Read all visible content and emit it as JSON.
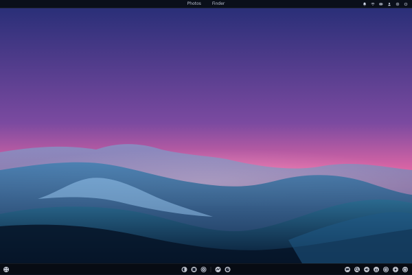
{
  "topbar": {
    "center_items": [
      "Photos",
      "Finder"
    ],
    "status_icons": [
      "bell-icon",
      "wifi-icon",
      "battery-icon",
      "user-icon",
      "gear-icon",
      "power-icon"
    ]
  },
  "wallpaper": {
    "sky_colors": [
      "#2b2e7a",
      "#ff6fa6",
      "#c7c8ff"
    ],
    "mountain_colors": [
      "#1b3b6b",
      "#2a6a8f",
      "#0f2747",
      "#7aa7d1"
    ]
  },
  "dock": {
    "left_icons": [
      "apps-icon"
    ],
    "center_icons": [
      "app-icon-1",
      "app-icon-2",
      "app-icon-3",
      "app-icon-4",
      "app-icon-5"
    ],
    "right_icons": [
      "chat-icon",
      "search-icon",
      "volume-icon",
      "network-icon",
      "clock-icon",
      "settings-icon",
      "power-icon"
    ]
  }
}
